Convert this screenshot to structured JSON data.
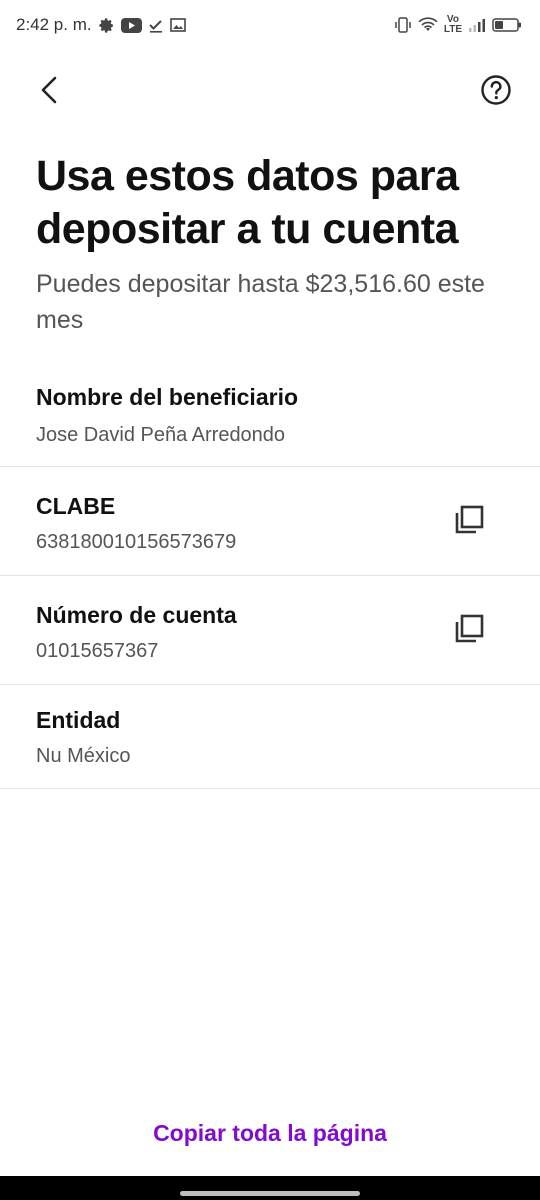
{
  "status_bar": {
    "time": "2:42 p. m.",
    "network_label_top": "Vo",
    "network_label_bottom": "LTE"
  },
  "header": {
    "title": "Usa estos datos para depositar a tu cuenta",
    "subtitle": "Puedes depositar hasta $23,516.60 este mes"
  },
  "rows": [
    {
      "label": "Nombre del beneficiario",
      "value": "Jose David Peña Arredondo",
      "copyable": false
    },
    {
      "label": "CLABE",
      "value": "638180010156573679",
      "copyable": true
    },
    {
      "label": "Número de cuenta",
      "value": "01015657367",
      "copyable": true
    },
    {
      "label": "Entidad",
      "value": "Nu México",
      "copyable": false
    }
  ],
  "footer": {
    "copy_all_label": "Copiar toda la página"
  },
  "colors": {
    "accent": "#820ad1",
    "text_primary": "#111111",
    "text_secondary": "#555555",
    "divider": "#e3e3e3"
  },
  "icons": {
    "back": "chevron-left-icon",
    "help": "question-circle-icon",
    "copy": "copy-icon"
  }
}
